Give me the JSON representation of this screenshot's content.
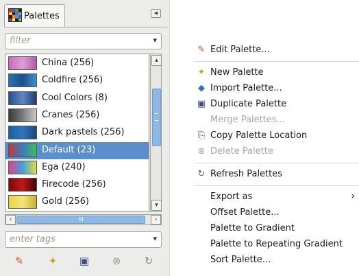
{
  "dock": {
    "tab_label": "Palettes",
    "filter_placeholder": "filter",
    "tags_placeholder": "enter tags",
    "palettes": [
      {
        "label": "China (256)",
        "colors": [
          "#c86db9",
          "#e09cd6",
          "#b35aa6"
        ]
      },
      {
        "label": "Coldfire (256)",
        "colors": [
          "#2a6fb0",
          "#1c4f8a",
          "#3b8fd4"
        ]
      },
      {
        "label": "Cool Colors (8)",
        "colors": [
          "#2c4e8a",
          "#5e86c6",
          "#233b6e"
        ]
      },
      {
        "label": "Cranes (256)",
        "colors": [
          "#3a3a3a",
          "#7a7a7a",
          "#c9c9c9"
        ]
      },
      {
        "label": "Dark pastels (256)",
        "colors": [
          "#1f5f9e",
          "#2d76bd",
          "#174878"
        ]
      },
      {
        "label": "Default (23)",
        "colors": [
          "#c03a3a",
          "#3a7ac0",
          "#3ac05a"
        ]
      },
      {
        "label": "Ega (240)",
        "colors": [
          "#e0408a",
          "#40a0e0",
          "#e0e040"
        ]
      },
      {
        "label": "Firecode (256)",
        "colors": [
          "#7a0a0a",
          "#c01818",
          "#400404"
        ]
      },
      {
        "label": "Gold (256)",
        "colors": [
          "#e8d24a",
          "#f4e67a",
          "#c8b030"
        ]
      }
    ],
    "selected_index": 5,
    "buttons": [
      {
        "name": "edit-palette-icon-button",
        "glyph": "✎"
      },
      {
        "name": "new-palette-icon-button",
        "glyph": "✦"
      },
      {
        "name": "duplicate-palette-icon-button",
        "glyph": "▣"
      },
      {
        "name": "delete-palette-icon-button",
        "glyph": "⊗"
      },
      {
        "name": "refresh-palettes-icon-button",
        "glyph": "↻"
      }
    ]
  },
  "menu": {
    "items": [
      {
        "label": "Edit Palette...",
        "icon": "✎",
        "disabled": false
      },
      {
        "separator": true
      },
      {
        "label": "New Palette",
        "icon": "✦",
        "disabled": false
      },
      {
        "label": "Import Palette...",
        "icon": "◆",
        "disabled": false
      },
      {
        "label": "Duplicate Palette",
        "icon": "▣",
        "disabled": false
      },
      {
        "label": "Merge Palettes...",
        "icon": "",
        "disabled": true
      },
      {
        "label": "Copy Palette Location",
        "icon": "⎘",
        "disabled": false
      },
      {
        "label": "Delete Palette",
        "icon": "⊗",
        "disabled": true
      },
      {
        "separator": true
      },
      {
        "label": "Refresh Palettes",
        "icon": "↻",
        "disabled": false
      },
      {
        "separator": true
      },
      {
        "label": "Export as",
        "icon": "",
        "disabled": false,
        "submenu": true
      },
      {
        "label": "Offset Palette...",
        "icon": "",
        "disabled": false
      },
      {
        "label": "Palette to Gradient",
        "icon": "",
        "disabled": false
      },
      {
        "label": "Palette to Repeating Gradient",
        "icon": "",
        "disabled": false
      },
      {
        "label": "Sort Palette...",
        "icon": "",
        "disabled": false
      }
    ]
  }
}
